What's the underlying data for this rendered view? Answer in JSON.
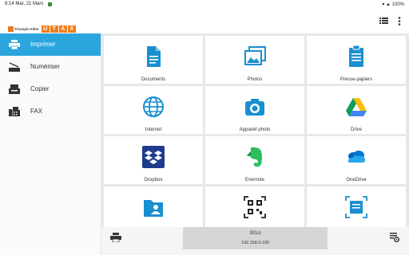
{
  "status": {
    "time": "8:14",
    "date": "Mar, 21 Mars",
    "system": "▾ ▲ 100%"
  },
  "header": {
    "logo_small": "Triumph-Adler",
    "logo_main": [
      "U",
      "T",
      "A",
      "X"
    ],
    "icons": [
      "list-icon",
      "settings-icon"
    ]
  },
  "sidebar": {
    "items": [
      {
        "label": "Imprimer",
        "icon": "printer-icon",
        "active": true
      },
      {
        "label": "Numériser",
        "icon": "scanner-icon",
        "active": false
      },
      {
        "label": "Copier",
        "icon": "copier-icon",
        "active": false
      },
      {
        "label": "FAX",
        "icon": "fax-icon",
        "active": false
      }
    ]
  },
  "tiles": [
    {
      "label": "Documents",
      "icon": "document-icon"
    },
    {
      "label": "Photos",
      "icon": "photos-icon"
    },
    {
      "label": "Presse-papiers",
      "icon": "clipboard-icon"
    },
    {
      "label": "Internet",
      "icon": "globe-icon"
    },
    {
      "label": "Appareil photo",
      "icon": "camera-icon"
    },
    {
      "label": "Drive",
      "icon": "drive-icon"
    },
    {
      "label": "Dropbox",
      "icon": "dropbox-icon"
    },
    {
      "label": "Evernote",
      "icon": "evernote-icon"
    },
    {
      "label": "OneDrive",
      "icon": "onedrive-icon"
    },
    {
      "label": "",
      "icon": "folder-user-icon"
    },
    {
      "label": "",
      "icon": "qr-code-icon"
    },
    {
      "label": "",
      "icon": "scan-document-icon"
    }
  ],
  "bottom": {
    "device_name": "301ci",
    "device_ip": "192.168.0.100",
    "left_icon": "printer-icon",
    "right_icon": "device-settings-icon"
  },
  "colors": {
    "accent": "#2aa6dd",
    "icon_blue": "#1a8fd0",
    "utax_orange": "#f07c1a"
  }
}
